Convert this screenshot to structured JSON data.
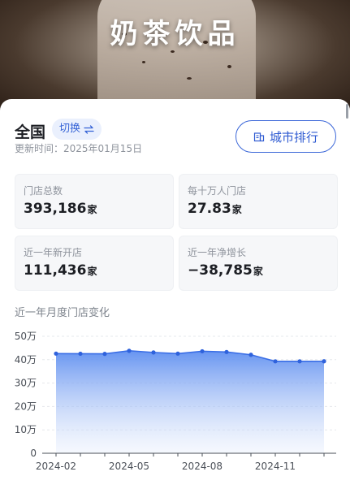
{
  "header": {
    "title": "奶茶饮品"
  },
  "summary": {
    "region": "全国",
    "switch_label": "切换",
    "update_time": "更新时间：2025年01月15日",
    "city_rank_label": "城市排行"
  },
  "stats": [
    {
      "label": "门店总数",
      "value": "393,186",
      "unit": "家"
    },
    {
      "label": "每十万人门店",
      "value": "27.83",
      "unit": "家"
    },
    {
      "label": "近一年新开店",
      "value": "111,436",
      "unit": "家"
    },
    {
      "label": "近一年净增长",
      "value": "−38,785",
      "unit": "家"
    }
  ],
  "chart_section": {
    "title": "近一年月度门店变化"
  },
  "colors": {
    "accent": "#3563d6",
    "line": "#3a6ee6",
    "area_top": "#6e98f0"
  },
  "chart_data": {
    "type": "area",
    "x": [
      "2024-02",
      "2024-03",
      "2024-04",
      "2024-05",
      "2024-06",
      "2024-07",
      "2024-08",
      "2024-09",
      "2024-10",
      "2024-11",
      "2024-12",
      "2025-01"
    ],
    "x_tick_labels": [
      "2024-02",
      "2024-05",
      "2024-08",
      "2024-11"
    ],
    "y_tick_labels": [
      "0",
      "10万",
      "20万",
      "30万",
      "40万",
      "50万"
    ],
    "series": [
      {
        "values": [
          426000,
          425500,
          425000,
          438000,
          431000,
          426000,
          436000,
          433000,
          421000,
          393000,
          393000,
          393186
        ]
      }
    ],
    "ylim": [
      0,
      500000
    ],
    "grid": true,
    "title": "近一年月度门店变化",
    "xlabel": "",
    "ylabel": ""
  }
}
